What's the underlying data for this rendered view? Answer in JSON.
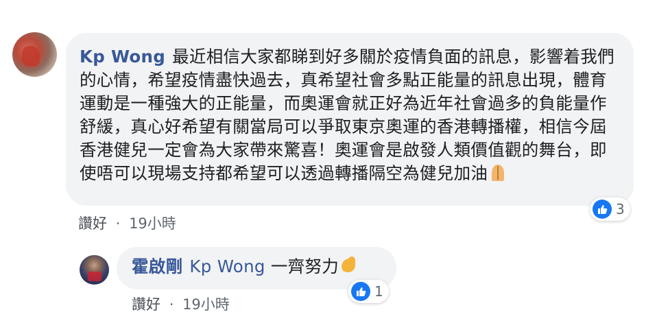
{
  "comment": {
    "author": "Kp Wong",
    "text": "最近相信大家都睇到好多關於疫情負面的訊息，影響着我們的心情，希望疫情盡快過去，真希望社會多點正能量的訊息出現，體育運動是一種強大的正能量，而奧運會就正好為近年社會過多的負能量作舒緩，真心好希望有關當局可以爭取東京奧運的香港轉播權，相信今屆香港健兒一定會為大家帶來驚喜！奧運會是啟發人類價值觀的舞台，即使唔可以現場支持都希望可以透過轉播隔空為健兒加油",
    "emoji": "folded-hands",
    "like_label": "讚好",
    "time": "19小時",
    "reaction_count": "3"
  },
  "reply": {
    "author": "霍啟剛",
    "tag": "Kp Wong",
    "text": "一齊努力",
    "emoji": "flexed-biceps",
    "like_label": "讚好",
    "time": "19小時",
    "reaction_count": "1"
  },
  "separator": "·",
  "colors": {
    "author_link": "#385898",
    "bubble": "#f2f3f5",
    "like_badge": "#1877f2",
    "meta": "#606770"
  }
}
